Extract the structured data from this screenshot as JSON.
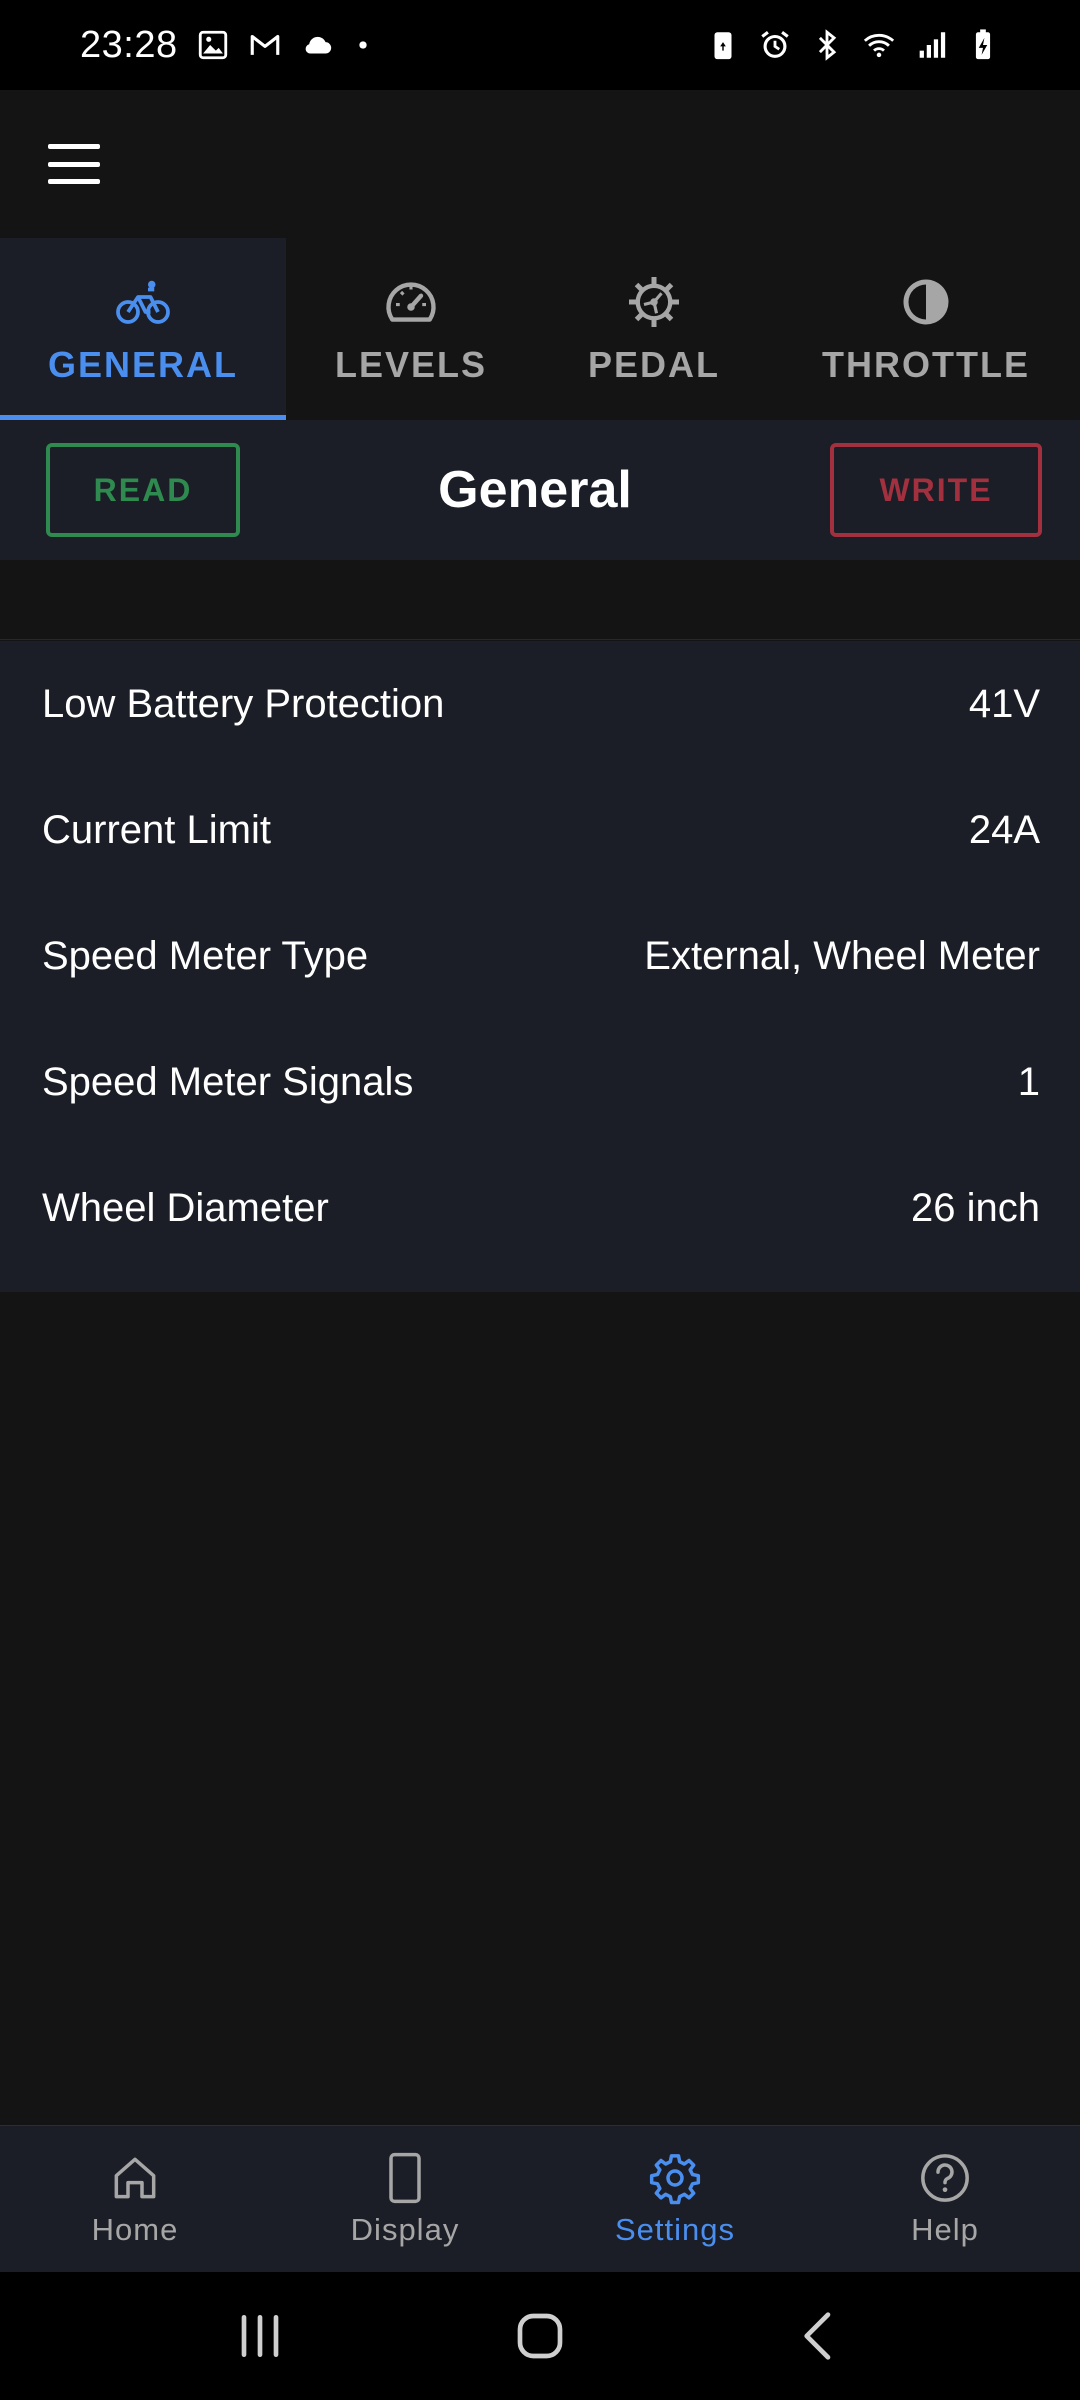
{
  "status_bar": {
    "time": "23:28",
    "left_icons": [
      "image-icon",
      "gmail-icon",
      "cloud-icon",
      "dot-icon"
    ],
    "right_icons": [
      "battery-saver-icon",
      "alarm-icon",
      "bluetooth-icon",
      "wifi-icon",
      "signal-icon",
      "battery-charging-icon"
    ]
  },
  "app_bar": {
    "menu_icon": "hamburger-menu-icon"
  },
  "tabs": [
    {
      "label": "GENERAL",
      "icon": "bicycle-icon",
      "active": true
    },
    {
      "label": "LEVELS",
      "icon": "speedometer-icon",
      "active": false
    },
    {
      "label": "PEDAL",
      "icon": "gear-icon",
      "active": false
    },
    {
      "label": "THROTTLE",
      "icon": "half-circle-icon",
      "active": false
    }
  ],
  "section": {
    "title": "General",
    "read_label": "READ",
    "write_label": "WRITE"
  },
  "settings": [
    {
      "label": "Low Battery Protection",
      "value": "41V"
    },
    {
      "label": "Current Limit",
      "value": "24A"
    },
    {
      "label": "Speed Meter Type",
      "value": "External, Wheel Meter"
    },
    {
      "label": "Speed Meter Signals",
      "value": "1"
    },
    {
      "label": "Wheel Diameter",
      "value": "26 inch"
    }
  ],
  "bottom_nav": [
    {
      "label": "Home",
      "icon": "home-icon",
      "active": false
    },
    {
      "label": "Display",
      "icon": "display-icon",
      "active": false
    },
    {
      "label": "Settings",
      "icon": "settings-gear-icon",
      "active": true
    },
    {
      "label": "Help",
      "icon": "help-icon",
      "active": false
    }
  ],
  "colors": {
    "accent": "#4a8ff0",
    "read": "#2e8a4e",
    "write": "#a3303f",
    "background": "#141414",
    "surface": "#1b1e26"
  }
}
